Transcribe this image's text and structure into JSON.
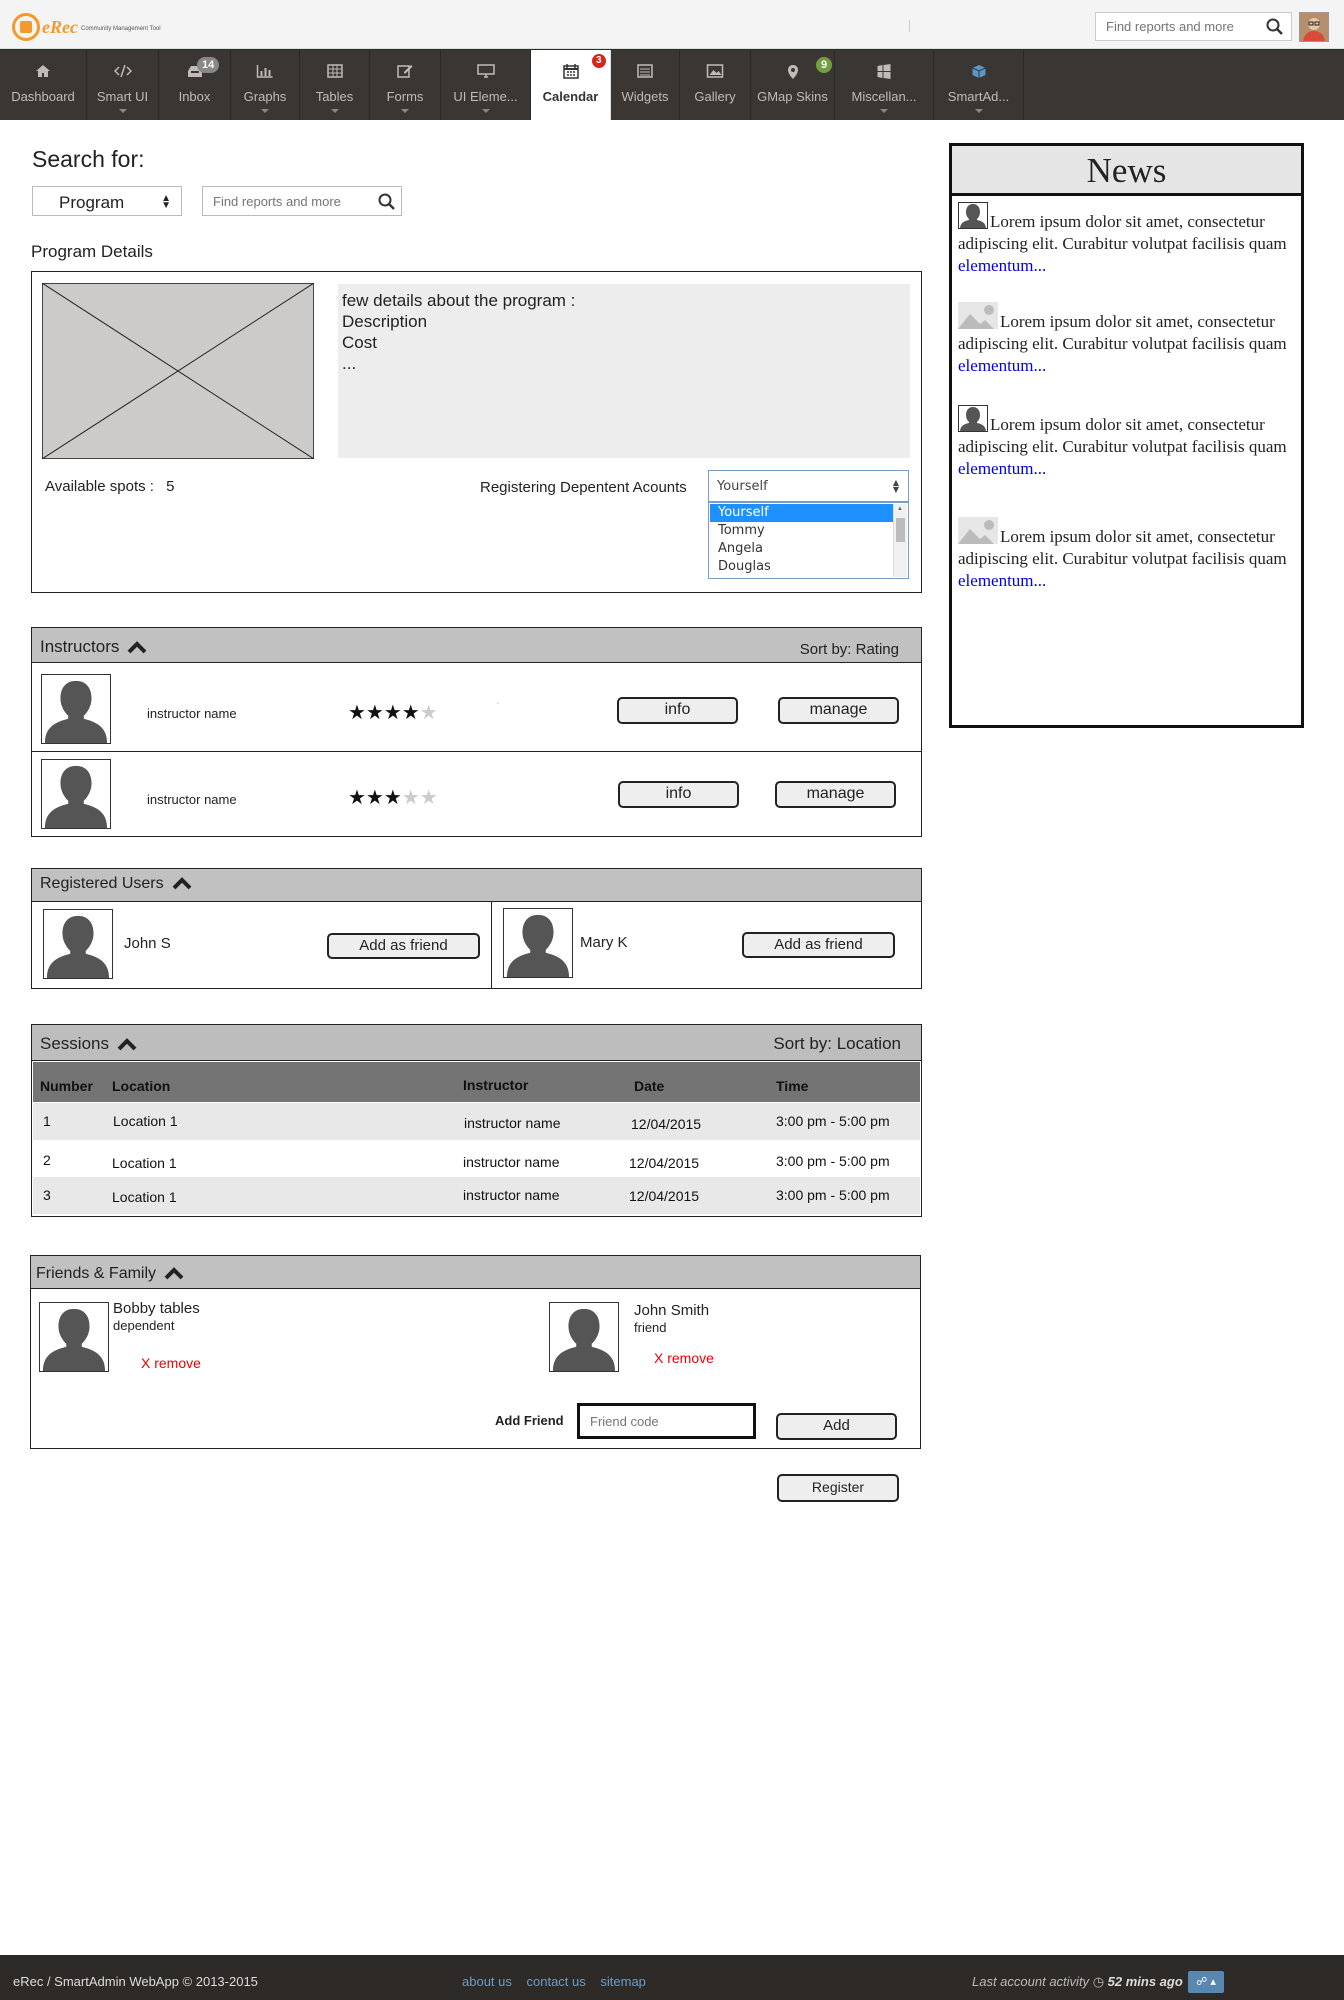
{
  "header": {
    "logo_name": "eRec",
    "logo_tagline": "Community Management Tool",
    "search_placeholder": "Find reports and more"
  },
  "nav": [
    {
      "label": "Dashboard",
      "icon": "home-icon"
    },
    {
      "label": "Smart UI",
      "icon": "code-icon"
    },
    {
      "label": "Inbox",
      "icon": "inbox-icon",
      "badge": "14"
    },
    {
      "label": "Graphs",
      "icon": "bar-chart-icon"
    },
    {
      "label": "Tables",
      "icon": "table-icon"
    },
    {
      "label": "Forms",
      "icon": "edit-icon"
    },
    {
      "label": "UI Eleme...",
      "icon": "desktop-icon"
    },
    {
      "label": "Calendar",
      "icon": "calendar-icon",
      "badge": "3"
    },
    {
      "label": "Widgets",
      "icon": "list-icon"
    },
    {
      "label": "Gallery",
      "icon": "picture-icon"
    },
    {
      "label": "GMap Skins",
      "icon": "map-marker-icon",
      "badge": "9"
    },
    {
      "label": "Miscellan...",
      "icon": "windows-icon"
    },
    {
      "label": "SmartAd...",
      "icon": "cube-icon"
    }
  ],
  "search": {
    "heading": "Search for:",
    "category": "Program",
    "placeholder": "Find reports and more"
  },
  "program": {
    "title": "Program Details",
    "details_lines": [
      "few details about the program :",
      "Description",
      "Cost",
      "..."
    ],
    "available_label": "Available spots :",
    "available_value": "5",
    "registering_label": "Registering Depentent Acounts",
    "dependent_selected": "Yourself",
    "dependent_options": [
      "Yourself",
      "Tommy",
      "Angela",
      "Douglas"
    ]
  },
  "instructors": {
    "title": "Instructors",
    "sort_label": "Sort by: Rating",
    "rows": [
      {
        "name": "instructor name",
        "rating": 4,
        "info": "info",
        "manage": "manage"
      },
      {
        "name": "instructor name",
        "rating": 3,
        "info": "info",
        "manage": "manage"
      }
    ]
  },
  "registered": {
    "title": "Registered Users",
    "users": [
      {
        "name": "John S",
        "action": "Add as friend"
      },
      {
        "name": "Mary K",
        "action": "Add as friend"
      }
    ]
  },
  "sessions": {
    "title": "Sessions",
    "sort_label": "Sort by: Location",
    "columns": [
      "Number",
      "Location",
      "Instructor",
      "Date",
      "Time"
    ],
    "rows": [
      [
        "1",
        "Location 1",
        "instructor name",
        "12/04/2015",
        "3:00 pm - 5:00 pm"
      ],
      [
        "2",
        "Location 1",
        "instructor name",
        "12/04/2015",
        "3:00 pm - 5:00 pm"
      ],
      [
        "3",
        "Location 1",
        "instructor name",
        "12/04/2015",
        "3:00 pm - 5:00 pm"
      ]
    ]
  },
  "friends": {
    "title": "Friends & Family",
    "people": [
      {
        "name": "Bobby tables",
        "relation": "dependent",
        "remove": "X remove"
      },
      {
        "name": "John Smith",
        "relation": "friend",
        "remove": "X remove"
      }
    ],
    "add_label": "Add Friend",
    "code_placeholder": "Friend code",
    "add_button": "Add"
  },
  "register_button": "Register",
  "news": {
    "title": "News",
    "items": [
      {
        "text": "Lorem ipsum dolor sit amet, consectetur adipiscing elit. Curabitur volutpat facilisis quam ",
        "link": "elementum...",
        "pic": "person-icon"
      },
      {
        "text": "Lorem ipsum dolor sit amet, consectetur adipiscing elit. Curabitur volutpat facilisis quam ",
        "link": "elementum...",
        "pic": "image-icon"
      },
      {
        "text": "Lorem ipsum dolor sit amet, consectetur adipiscing elit. Curabitur volutpat facilisis quam ",
        "link": "elementum...",
        "pic": "person-icon"
      },
      {
        "text": "Lorem ipsum dolor sit amet, consectetur adipiscing elit. Curabitur volutpat facilisis quam ",
        "link": "elementum...",
        "pic": "image-icon"
      }
    ]
  },
  "footer": {
    "copyright": "eRec / SmartAdmin WebApp © 2013-2015",
    "links": [
      "about us",
      "contact us",
      "sitemap"
    ],
    "activity_label": "Last account activity",
    "activity_value": "52 mins ago"
  },
  "colors": {
    "nav_bg": "#3a3633",
    "logo": "#f29a2e",
    "panel_header": "#c1c1c1",
    "remove_red": "#e00000",
    "link_blue": "#0000ee"
  }
}
